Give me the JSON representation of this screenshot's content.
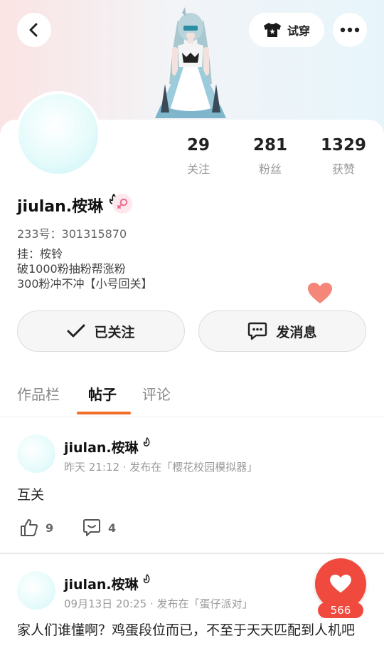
{
  "header": {
    "back_icon": "back-arrow-icon",
    "try_on_label": "试穿",
    "try_on_icon": "tshirt-icon",
    "more_icon": "more-dots-icon"
  },
  "profile": {
    "name": "jiulan.桉琳",
    "name_badge_icon": "flame-badge-icon",
    "gender_icon": "female-icon",
    "uid_text": "233号：301315870",
    "bio": [
      "挂：桉铃",
      "破1000粉抽粉帮涨粉",
      "300粉冲不冲【小号回关】"
    ],
    "stats": [
      {
        "value": "29",
        "label": "关注"
      },
      {
        "value": "281",
        "label": "粉丝"
      },
      {
        "value": "1329",
        "label": "获赞"
      }
    ]
  },
  "actions": {
    "follow_label": "已关注",
    "message_label": "发消息"
  },
  "tabs": [
    {
      "label": "作品栏",
      "active": false
    },
    {
      "label": "帖子",
      "active": true
    },
    {
      "label": "评论",
      "active": false
    }
  ],
  "posts": [
    {
      "author": "jiulan.桉琳",
      "meta": "昨天 21:12 · 发布在「樱花校园模拟器」",
      "body": "互关",
      "likes": "9",
      "comments": "4"
    },
    {
      "author": "jiulan.桉琳",
      "meta": "09月13日 20:25 · 发布在「蛋仔派对」",
      "body": "家人们谁懂啊？鸡蛋段位而已，不至于天天匹配到人机吧"
    }
  ],
  "floating_like": {
    "count": "566"
  },
  "colors": {
    "accent": "#f26d2a",
    "fab_red": "#f04a3e",
    "heart_salmon": "#f6857a"
  }
}
